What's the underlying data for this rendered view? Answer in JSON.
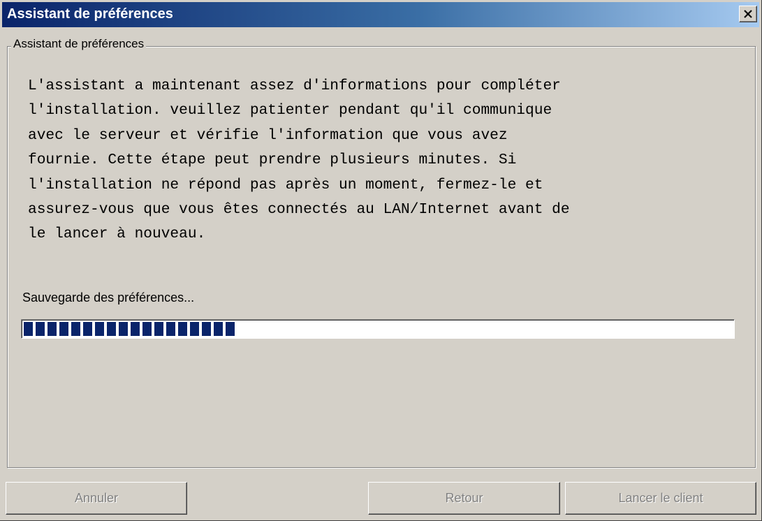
{
  "window": {
    "title": "Assistant de préférences",
    "close_icon": "close-icon"
  },
  "group": {
    "legend": "Assistant de préférences"
  },
  "message": "L'assistant a maintenant assez d'informations pour compléter\nl'installation. veuillez patienter pendant qu'il communique\navec le serveur et vérifie l'information que vous avez\nfournie. Cette étape peut prendre plusieurs minutes. Si\nl'installation ne répond pas après un moment, fermez-le et\nassurez-vous que vous êtes connectés au LAN/Internet avant de\nle lancer à nouveau.",
  "status": {
    "label": "Sauvegarde des préférences...",
    "progress_fraction": 0.3,
    "progress_color": "#0a246a"
  },
  "buttons": {
    "cancel": "Annuler",
    "back": "Retour",
    "launch": "Lancer le client"
  },
  "colors": {
    "title_gradient_start": "#0a246a",
    "title_gradient_end": "#a6caf0",
    "face": "#d4d0c8",
    "disabled_text": "#808080"
  }
}
